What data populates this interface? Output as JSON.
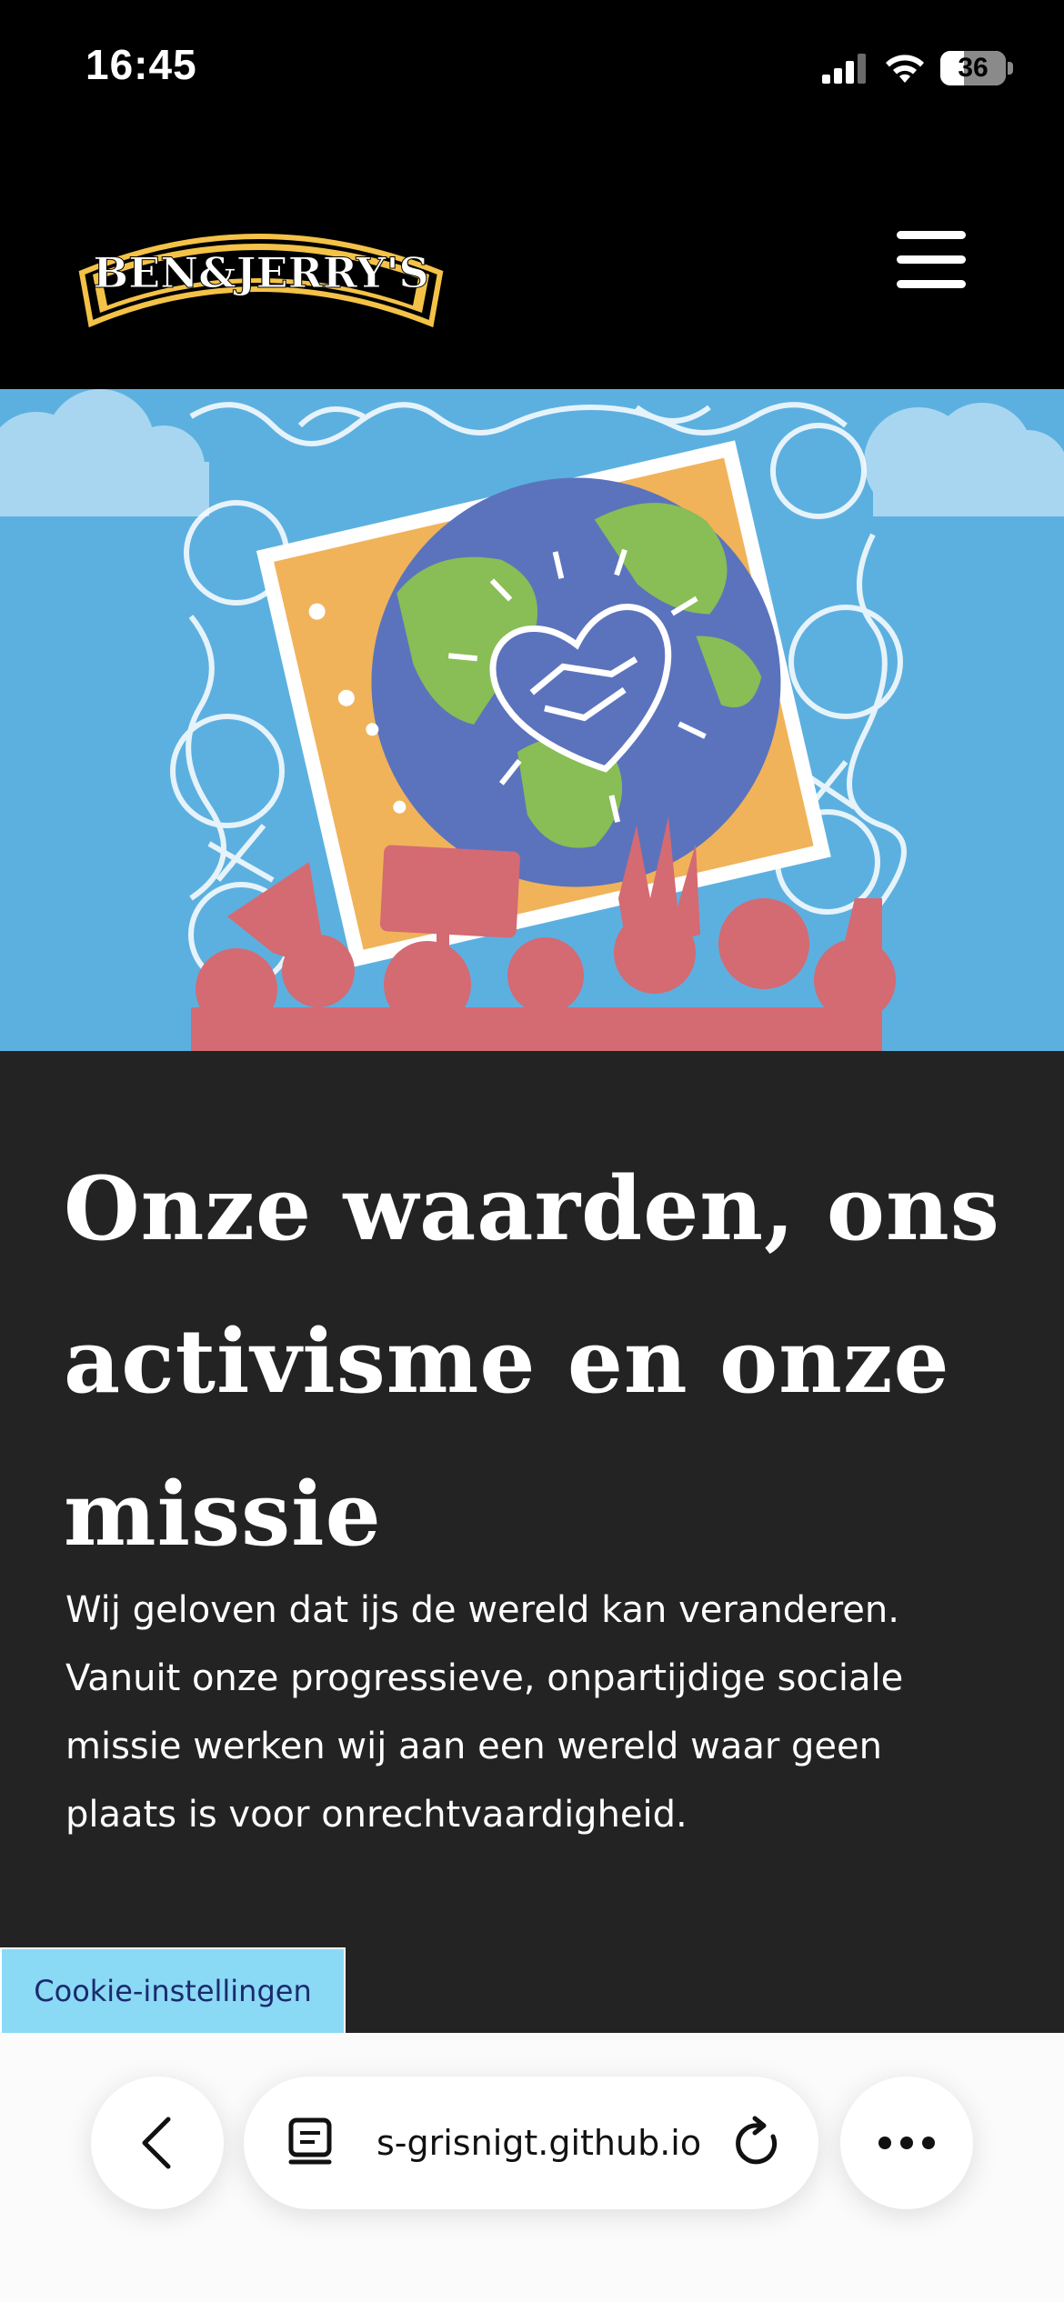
{
  "status_bar": {
    "time": "16:45",
    "battery_level": "36",
    "battery_fraction": 0.36
  },
  "header": {
    "logo_text": "BEN&JERRY'S",
    "menu_icon": "hamburger-menu-icon"
  },
  "hero": {
    "image_subject": "earth-stamp-handshake-heart-crowd-illustration",
    "colors": {
      "sky": "#5cb0e0",
      "stamp_orange": "#f0b35a",
      "ocean": "#5b73bd",
      "land": "#89bd55",
      "crowd": "#d46a72"
    }
  },
  "content": {
    "title": "Onze waarden, ons activisme en onze missie",
    "intro": "Wij geloven dat ijs de wereld kan veranderen. Vanuit onze progressieve, onpartijdige sociale missie werken wij aan een wereld waar geen plaats is voor onrechtvaardigheid."
  },
  "cookie": {
    "label": "Cookie-instellingen"
  },
  "browser": {
    "url": "s-grisnigt.github.io",
    "back_icon": "chevron-left-icon",
    "reader_icon": "reader-mode-icon",
    "reload_icon": "reload-icon",
    "more_icon": "more-dots-icon"
  },
  "colors": {
    "header_bg": "#000000",
    "content_bg": "#232323",
    "cookie_bg": "#8ad9f5",
    "cookie_text": "#1b2a6e",
    "logo_gold": "#f3c247"
  }
}
